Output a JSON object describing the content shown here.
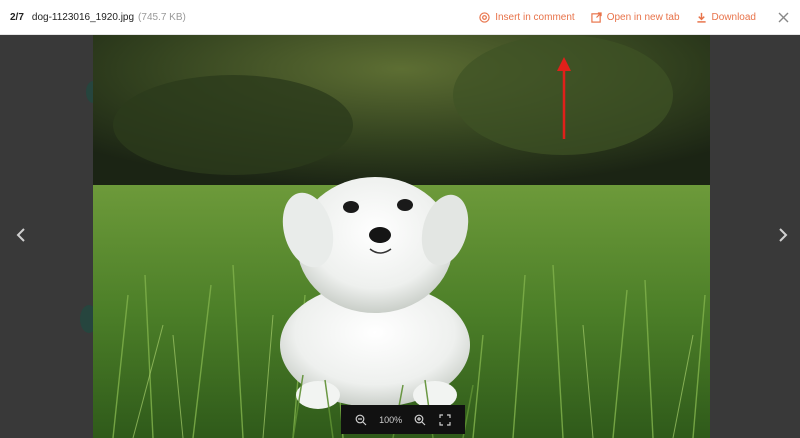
{
  "header": {
    "counter": "2/7",
    "filename": "dog-1123016_1920.jpg",
    "filesize": "(745.7 KB)",
    "actions": {
      "insert_label": "Insert in comment",
      "open_label": "Open in new tab",
      "download_label": "Download"
    }
  },
  "zoom": {
    "level": "100%"
  },
  "colors": {
    "accent": "#e8734a",
    "annotation_arrow": "#e0201a"
  },
  "icons": {
    "insert": "at-sign-icon",
    "open": "external-link-icon",
    "download": "download-icon",
    "close": "close-icon",
    "prev": "chevron-left-icon",
    "next": "chevron-right-icon",
    "zoom_out": "zoom-out-icon",
    "zoom_in": "zoom-in-icon",
    "fullscreen": "fullscreen-icon"
  }
}
